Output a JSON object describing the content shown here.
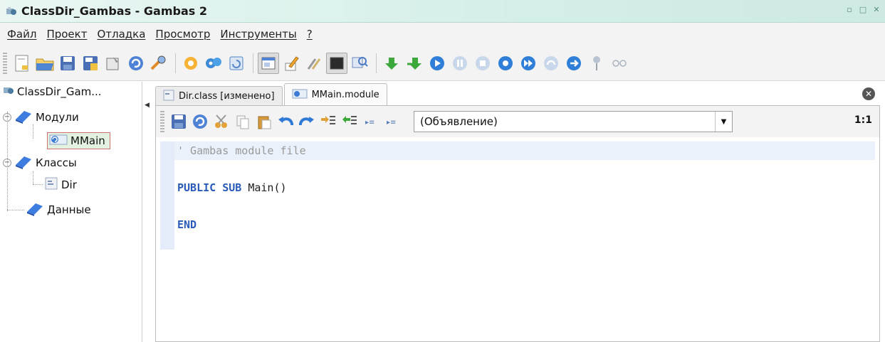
{
  "window": {
    "title": "ClassDir_Gambas - Gambas 2"
  },
  "menu": [
    "Файл",
    "Проект",
    "Отладка",
    "Просмотр",
    "Инструменты",
    "?"
  ],
  "toolbar_icons": [
    "new-file-icon",
    "open-folder-icon",
    "save-icon",
    "save-all-icon",
    "properties-icon",
    "refresh-icon",
    "search-icon",
    "compile-icon",
    "settings-icon",
    "window-icon",
    "form-view-icon",
    "edit-icon",
    "tools-icon",
    "terminal-icon",
    "zoom-icon",
    "arrow-down-icon",
    "step-icon",
    "play-icon",
    "pause-icon",
    "stop-icon",
    "record-icon",
    "fast-forward-icon",
    "step-over-icon",
    "next-icon",
    "pin-icon",
    "glasses-icon"
  ],
  "tree": {
    "root": "ClassDir_Gam...",
    "items": [
      {
        "label": "Модули",
        "type": "folder"
      },
      {
        "label": "MMain",
        "type": "module",
        "selected": true
      },
      {
        "label": "Классы",
        "type": "folder"
      },
      {
        "label": "Dir",
        "type": "class"
      },
      {
        "label": "Данные",
        "type": "folder"
      }
    ]
  },
  "tabs": [
    {
      "label": "Dir.class [изменено]",
      "active": false
    },
    {
      "label": "MMain.module",
      "active": true
    }
  ],
  "editor": {
    "procedure_combo": "(Объявление)",
    "cursor_position": "1:1",
    "code_lines": [
      {
        "kind": "comment",
        "text": "' Gambas module file"
      },
      {
        "kind": "blank",
        "text": ""
      },
      {
        "kind": "code",
        "kw": "PUBLIC SUB",
        "rest": " Main()"
      },
      {
        "kind": "blank",
        "text": ""
      },
      {
        "kind": "code",
        "kw": "END",
        "rest": ""
      }
    ]
  },
  "colors": {
    "titlebar": "#d4efe8",
    "keyword": "#2a5bb8",
    "comment": "#9a9a9a",
    "selection_border": "#d07070"
  }
}
